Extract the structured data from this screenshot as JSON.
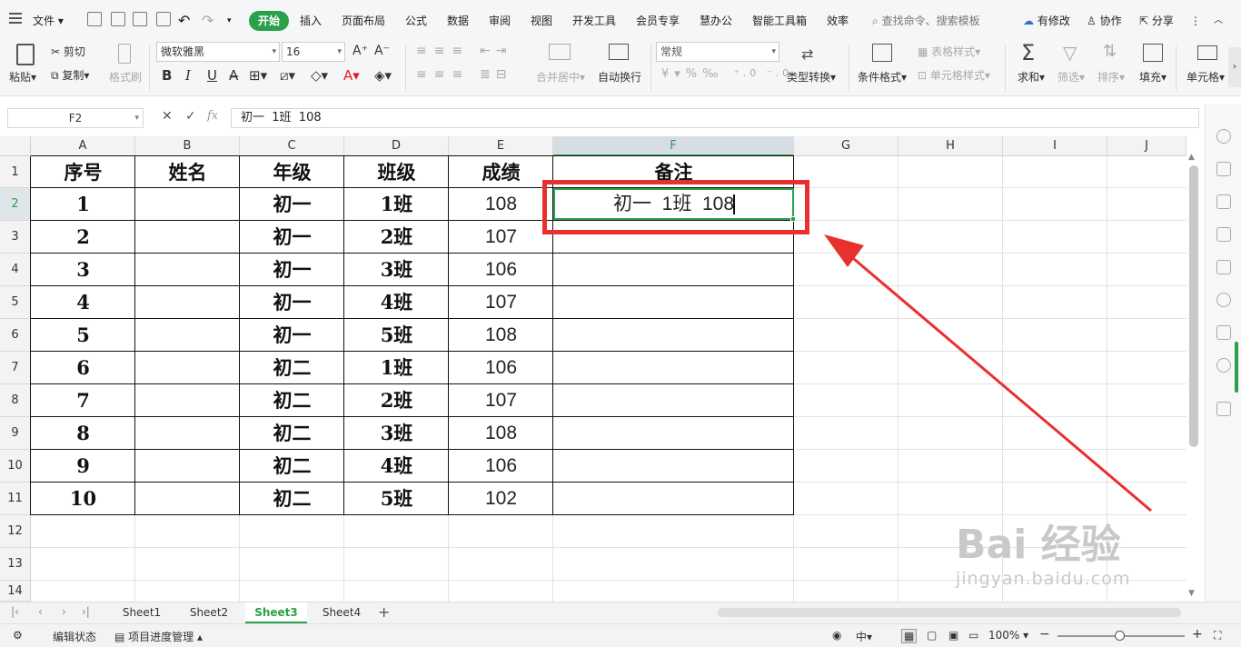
{
  "menubar": {
    "file_label": "文件",
    "tabs": [
      "开始",
      "插入",
      "页面布局",
      "公式",
      "数据",
      "审阅",
      "视图",
      "开发工具",
      "会员专享",
      "慧办公",
      "智能工具箱",
      "效率"
    ],
    "search_placeholder": "查找命令、搜索模板",
    "has_changes": "有修改",
    "collab": "协作",
    "share": "分享"
  },
  "ribbon": {
    "paste": "粘贴",
    "cut": "剪切",
    "copy": "复制",
    "format_painter": "格式刷",
    "font_name": "微软雅黑",
    "font_size": "16",
    "merge_center": "合并居中",
    "wrap_text": "自动换行",
    "number_format": "常规",
    "type_convert": "类型转换",
    "cond_format": "条件格式",
    "table_style": "表格样式",
    "cell_style": "单元格样式",
    "sum": "求和",
    "filter": "筛选",
    "sort": "排序",
    "fill": "填充",
    "cell": "单元格",
    "bold": "B",
    "italic": "I",
    "underline": "U",
    "font_color_accent": "#e02020"
  },
  "formula_bar": {
    "cell_ref": "F2",
    "fx": "fx",
    "content": "初一  1班  108"
  },
  "columns": [
    "A",
    "B",
    "C",
    "D",
    "E",
    "F",
    "G",
    "H",
    "I",
    "J"
  ],
  "selected_column": "F",
  "rows": [
    "1",
    "2",
    "3",
    "4",
    "5",
    "6",
    "7",
    "8",
    "9",
    "10",
    "11",
    "12",
    "13",
    "14"
  ],
  "selected_row": "2",
  "table": {
    "headers": [
      "序号",
      "姓名",
      "年级",
      "班级",
      "成绩",
      "备注"
    ],
    "data": [
      [
        "1",
        "",
        "初一",
        "1班",
        "108",
        "初一  1班  108"
      ],
      [
        "2",
        "",
        "初一",
        "2班",
        "107",
        ""
      ],
      [
        "3",
        "",
        "初一",
        "3班",
        "106",
        ""
      ],
      [
        "4",
        "",
        "初一",
        "4班",
        "107",
        ""
      ],
      [
        "5",
        "",
        "初一",
        "5班",
        "108",
        ""
      ],
      [
        "6",
        "",
        "初二",
        "1班",
        "106",
        ""
      ],
      [
        "7",
        "",
        "初二",
        "2班",
        "107",
        ""
      ],
      [
        "8",
        "",
        "初二",
        "3班",
        "108",
        ""
      ],
      [
        "9",
        "",
        "初二",
        "4班",
        "106",
        ""
      ],
      [
        "10",
        "",
        "初二",
        "5班",
        "102",
        ""
      ]
    ]
  },
  "sheets": [
    "Sheet1",
    "Sheet2",
    "Sheet3",
    "Sheet4"
  ],
  "active_sheet": "Sheet3",
  "status": {
    "edit_state": "编辑状态",
    "project": "项目进度管理",
    "zoom": "100%"
  },
  "annotation": {
    "highlight_color": "#e8302f"
  },
  "watermark": {
    "brand": "Bai 经验",
    "url": "jingyan.baidu.com"
  }
}
